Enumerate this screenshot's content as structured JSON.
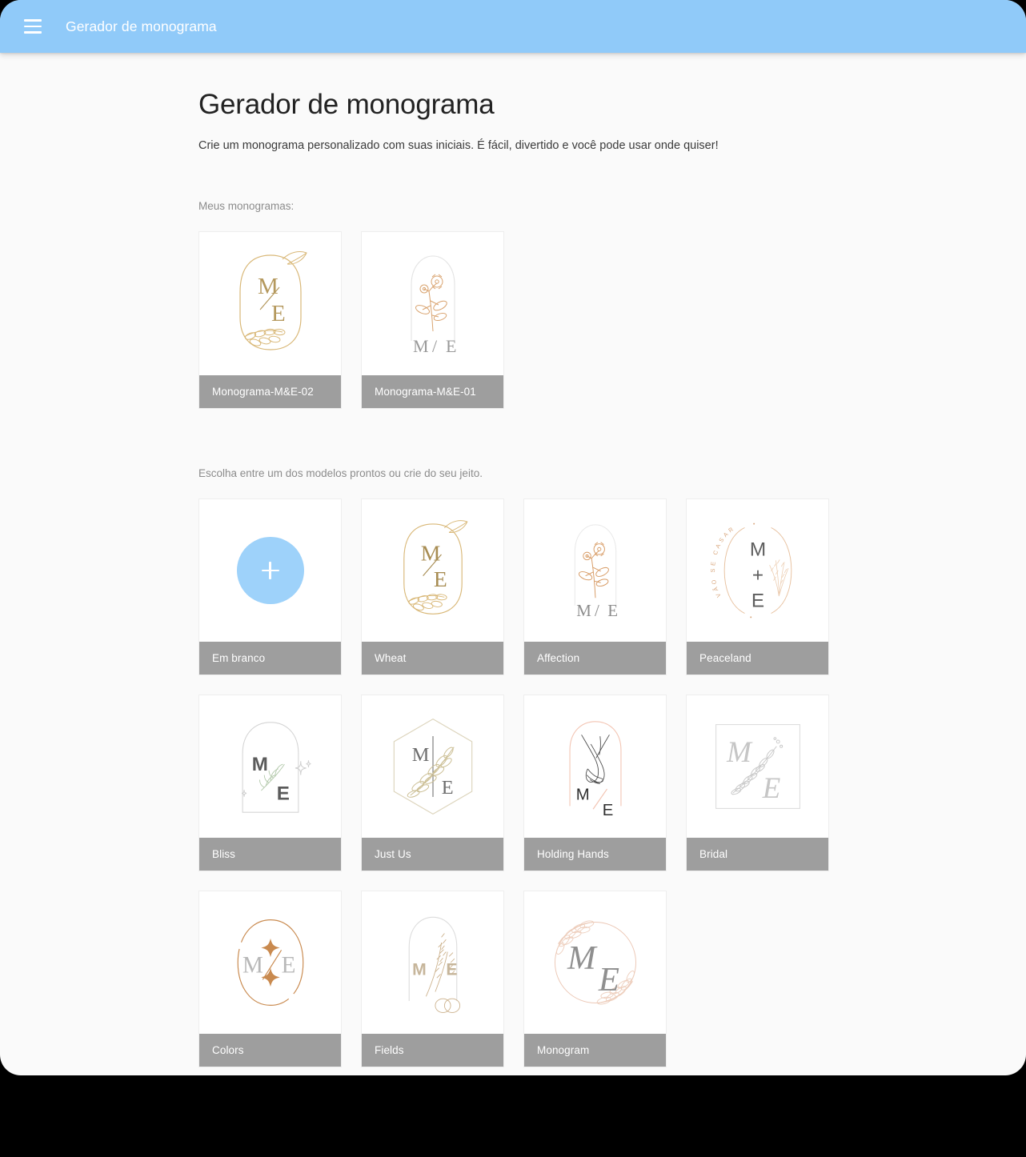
{
  "appbar": {
    "menu_icon": "hamburger-menu-icon",
    "title": "Gerador de monograma",
    "background_color": "#90caf9"
  },
  "page": {
    "title": "Gerador de monograma",
    "subtitle": "Crie um monograma personalizado com suas iniciais. É fácil, divertido e você pode usar onde quiser!",
    "background_color": "#fafafa"
  },
  "my_monograms": {
    "label": "Meus monogramas:",
    "items": [
      {
        "label": "Monograma-M&E-02",
        "art": "wheat-oval-frame",
        "initials": [
          "M",
          "E"
        ],
        "accent": "#d9b878"
      },
      {
        "label": "Monograma-M&E-01",
        "art": "arch-flower-stem",
        "initials": [
          "M",
          "E"
        ],
        "accent": "#e0b98f"
      }
    ]
  },
  "templates": {
    "label": "Escolha entre um dos modelos prontos ou crie do seu jeito.",
    "items": [
      {
        "label": "Em branco",
        "art": "add-plus-circle",
        "accent": "#9ed2fa"
      },
      {
        "label": "Wheat",
        "art": "wheat-oval-frame",
        "initials": [
          "M",
          "E"
        ],
        "accent": "#d9b878"
      },
      {
        "label": "Affection",
        "art": "arch-flower-stem",
        "initials": [
          "M",
          "E"
        ],
        "accent": "#d79a63"
      },
      {
        "label": "Peaceland",
        "art": "peaceland-arc-text",
        "initials": [
          "M",
          "E"
        ],
        "arc_text": "VÃO SE CASAR",
        "separator": "+",
        "accent": "#e3b894"
      },
      {
        "label": "Bliss",
        "art": "arch-sparkles-leaf",
        "initials": [
          "M",
          "E"
        ],
        "accent": "#b9c9b2"
      },
      {
        "label": "Just Us",
        "art": "hexagon-leaf-divider",
        "initials": [
          "M",
          "E"
        ],
        "accent": "#d8cfb4"
      },
      {
        "label": "Holding Hands",
        "art": "holding-hands-arch",
        "initials": [
          "M",
          "E"
        ],
        "accent": "#f0c4b4"
      },
      {
        "label": "Bridal",
        "art": "square-script-branch",
        "initials": [
          "M",
          "E"
        ],
        "accent": "#cfcfcf"
      },
      {
        "label": "Colors",
        "art": "circle-sparkle-slash",
        "initials": [
          "M",
          "E"
        ],
        "accent": "#c98a4f"
      },
      {
        "label": "Fields",
        "art": "arch-wheat-rings",
        "initials": [
          "M",
          "E"
        ],
        "accent": "#d9c3a2"
      },
      {
        "label": "Monogram",
        "art": "laurel-wreath-script",
        "initials": [
          "M",
          "E"
        ],
        "accent": "#e8c6b4"
      }
    ]
  },
  "colors": {
    "card_label_bg": "#9e9e9e",
    "card_bg": "#ffffff",
    "accent_blue": "#90caf9"
  }
}
